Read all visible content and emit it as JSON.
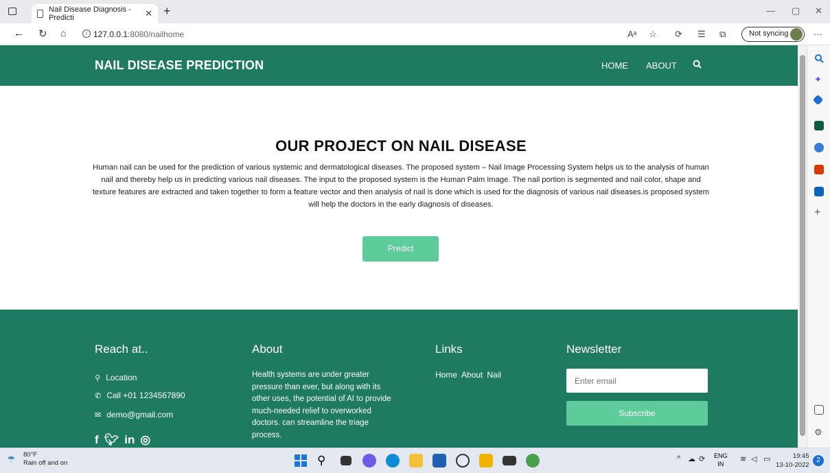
{
  "browser": {
    "tab_title": "Nail Disease Diagnosis - Predicti",
    "url_host": "127.0.0.1",
    "url_port_path": ":8080/nailhome",
    "sync_label": "Not syncing"
  },
  "header": {
    "brand": "NAIL DISEASE PREDICTION",
    "nav": [
      "HOME",
      "ABOUT"
    ]
  },
  "hero": {
    "title": "OUR PROJECT ON NAIL DISEASE",
    "text": "Human nail can be used for the prediction of various systemic and dermatological diseases. The proposed system – Nail Image Processing System helps us to the analysis of human nail and thereby help us in predicting various nail diseases. The input to the proposed system is the Human Palm Image. The nail portion is segmented and nail color, shape and texture features are extracted and taken together to form a feature vector and then analysis of nail is done which is used for the diagnosis of various nail diseases.is proposed system will help the doctors in the early diagnosis of diseases.",
    "button": "Predict"
  },
  "footer": {
    "reach_title": "Reach at..",
    "location": "Location",
    "phone": "Call +01 1234567890",
    "email": "demo@gmail.com",
    "about_title": "About",
    "about_text": "Health systems are under greater pressure than ever, but along with its other uses, the potential of AI to provide much-needed relief to overworked doctors. can streamline the triage process.",
    "links_title": "Links",
    "links": [
      "Home",
      "About",
      "Nail"
    ],
    "newsletter_title": "Newsletter",
    "email_placeholder": "Enter email",
    "subscribe": "Subscribe"
  },
  "taskbar": {
    "temp": "80°F",
    "weather": "Rain off and on",
    "lang1": "ENG",
    "lang2": "IN",
    "time": "19:45",
    "date": "13-10-2022"
  },
  "colors": {
    "primary": "#1f7a62",
    "accent": "#5ecb9a"
  }
}
